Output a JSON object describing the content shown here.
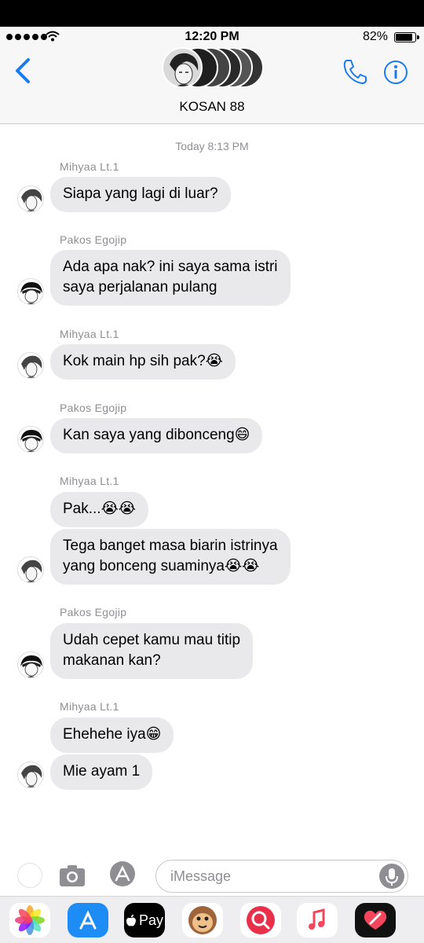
{
  "status_bar": {
    "time": "12:20 PM",
    "battery": "82%"
  },
  "header": {
    "group_name": "KOSAN 88"
  },
  "conversation": {
    "timestamp": "Today 8:13 PM",
    "blocks": [
      {
        "sender": "Mihyaa Lt.1",
        "messages": [
          "Siapa yang lagi di luar?"
        ]
      },
      {
        "sender": "Pakos Egojip",
        "messages": [
          "Ada apa nak? ini saya sama istri\nsaya perjalanan pulang"
        ]
      },
      {
        "sender": "Mihyaa Lt.1",
        "messages": [
          "Kok main hp sih pak?😭"
        ]
      },
      {
        "sender": "Pakos Egojip",
        "messages": [
          "Kan saya yang dibonceng😄"
        ]
      },
      {
        "sender": "Mihyaa Lt.1",
        "messages": [
          "Pak...😭😭",
          "Tega banget masa biarin istrinya\nyang bonceng suaminya😭😭"
        ]
      },
      {
        "sender": "Pakos Egojip",
        "messages": [
          "Udah cepet kamu mau titip\nmakanan kan?"
        ]
      },
      {
        "sender": "Mihyaa Lt.1",
        "messages": [
          "Ehehehe iya😁",
          "Mie ayam 1"
        ]
      }
    ]
  },
  "composer": {
    "placeholder": "iMessage"
  },
  "app_drawer": {
    "apps": [
      {
        "name": "photos-app-icon",
        "bg": "#ffffff"
      },
      {
        "name": "app-store-icon",
        "bg": "#1e8cf5"
      },
      {
        "name": "apple-pay-icon",
        "bg": "#000000",
        "label": "Pay"
      },
      {
        "name": "animoji-icon",
        "bg": "#ffffff"
      },
      {
        "name": "web-images-icon",
        "bg": "#e8304a"
      },
      {
        "name": "music-icon",
        "bg": "#ffffff"
      },
      {
        "name": "digital-touch-icon",
        "bg": "#111111"
      }
    ]
  },
  "colors": {
    "accent": "#1a7cf0",
    "bubble": "#e9e9eb",
    "meta_text": "#8e8e93"
  }
}
